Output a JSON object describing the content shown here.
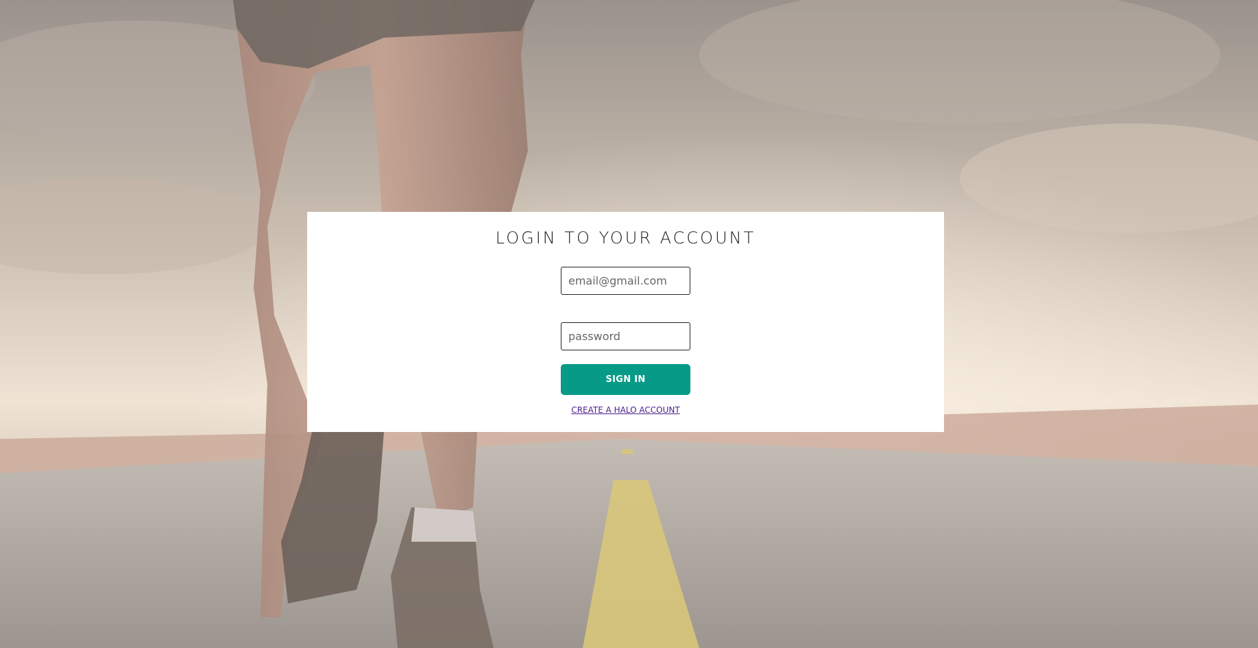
{
  "login": {
    "title": "LOGIN TO YOUR ACCOUNT",
    "email_placeholder": "email@gmail.com",
    "password_placeholder": "password",
    "signin_label": "SIGN IN",
    "create_account_label": "CREATE A HALO ACCOUNT"
  },
  "colors": {
    "accent": "#079b87",
    "link": "#4b1d8c",
    "card": "#ffffff"
  },
  "background": {
    "image_subject": "runner-legs-on-desert-road"
  }
}
